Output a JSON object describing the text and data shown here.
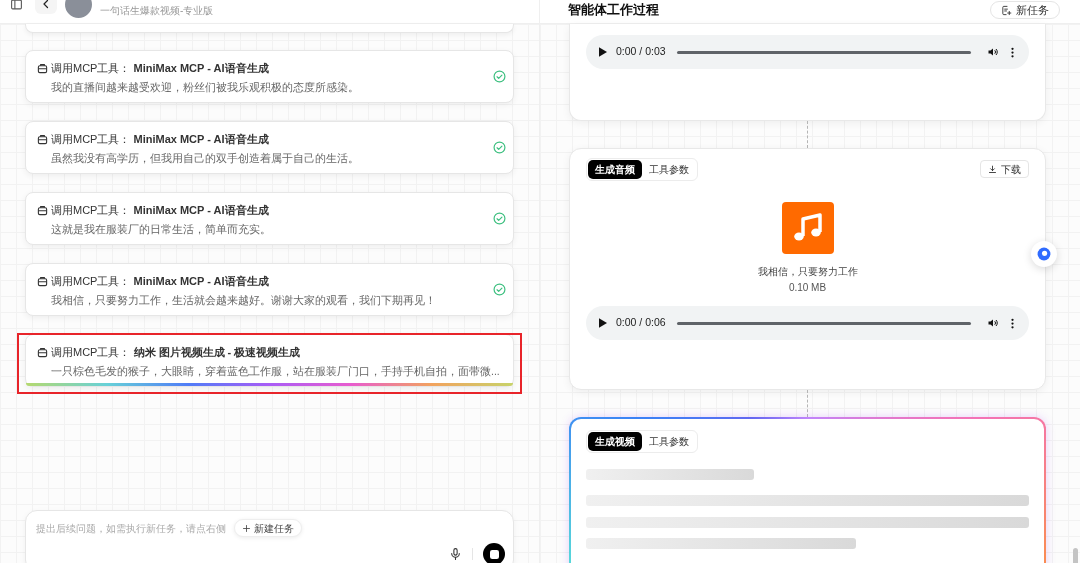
{
  "header": {
    "subtitle": "一句话生爆款视频-专业版"
  },
  "tool_calls": [
    {
      "title": "调用MCP工具： **MiniMax MCP - AI语音生成**",
      "text": "我的直播间越来越受欢迎，粉丝们被我乐观积极的态度所感染。",
      "completed": true,
      "highlighted": false
    },
    {
      "title": "调用MCP工具： **MiniMax MCP - AI语音生成**",
      "text": "虽然我没有高学历，但我用自己的双手创造着属于自己的生活。",
      "completed": true,
      "highlighted": false
    },
    {
      "title": "调用MCP工具： **MiniMax MCP - AI语音生成**",
      "text": "这就是我在服装厂的日常生活，简单而充实。",
      "completed": true,
      "highlighted": false
    },
    {
      "title": "调用MCP工具： **MiniMax MCP - AI语音生成**",
      "text": "我相信，只要努力工作，生活就会越来越好。谢谢大家的观看，我们下期再见！",
      "completed": true,
      "highlighted": false
    },
    {
      "title": "调用MCP工具： **纳米 图片视频生成 - 极速视频生成**",
      "text": "一只棕色毛发的猴子，大眼睛，穿着蓝色工作服，站在服装厂门口，手持手机自拍，面带微...",
      "completed": false,
      "highlighted": true
    }
  ],
  "composer": {
    "placeholder": "提出后续问题，如需执行新任务，请点右侧",
    "new_task_button": "新建任务"
  },
  "workflow": {
    "title": "智能体工作过程",
    "new_task_button": "新任务",
    "cards": [
      {
        "kind": "audio_player",
        "time": "0:00 / 0:03"
      },
      {
        "kind": "audio_file",
        "tabs": [
          {
            "label": "生成音频",
            "selected": true
          },
          {
            "label": "工具参数",
            "selected": false
          }
        ],
        "download_button": "下载",
        "file_name": "我相信，只要努力工作",
        "file_size": "0.10 MB",
        "time": "0:00 / 0:06"
      },
      {
        "kind": "video",
        "tabs": [
          {
            "label": "生成视频",
            "selected": true
          },
          {
            "label": "工具参数",
            "selected": false
          }
        ],
        "loading": true
      }
    ]
  }
}
